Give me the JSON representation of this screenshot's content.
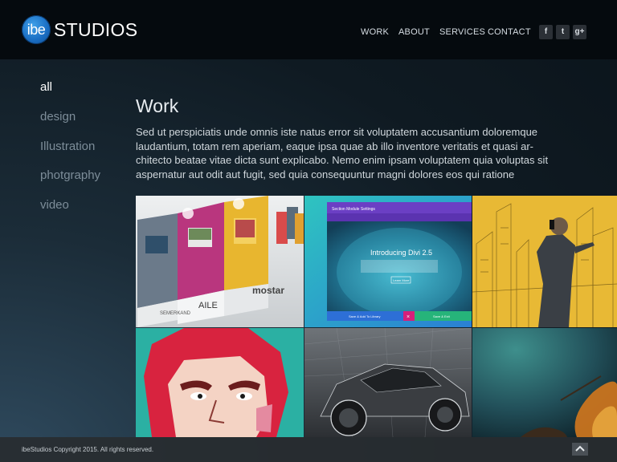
{
  "brand": {
    "logo_mark": "ibe",
    "logo_text": "STUDIOS"
  },
  "nav": {
    "items": [
      "WORK",
      "ABOUT",
      "SERVICES",
      "CONTACT"
    ]
  },
  "social": {
    "facebook": "f",
    "twitter": "t",
    "googleplus": "g+"
  },
  "sidebar": {
    "items": [
      "all",
      "design",
      "Illustration",
      "photgraphy",
      "video"
    ],
    "active": "all"
  },
  "main": {
    "title": "Work",
    "intro": "Sed ut perspiciatis unde omnis iste natus error sit voluptatem accusantium doloremque laudantium, totam rem aperiam, eaque ipsa quae ab illo inventore veritatis et quasi ar-chitecto beatae vitae dicta sunt explicabo. Nemo enim ipsam voluptatem quia voluptas sit aspernatur aut odit aut fugit, sed quia consequuntur magni dolores eos qui ratione"
  },
  "portfolio": {
    "brochure": {
      "label1": "SEMERKAND",
      "label2": "AILE",
      "label3": "mostar"
    },
    "divi": {
      "modal_title": "Section Module Settings",
      "headline": "Introducing Divi 2.5",
      "button": "Learn More",
      "save_library": "Save & Add To Library",
      "close": "×",
      "save_exit": "Save & Exit"
    }
  },
  "footer": {
    "copyright": "ibeStudios Copyright 2015. All rights reserved."
  },
  "colors": {
    "header": "#050a0e",
    "accent": "#1b6fc4",
    "active_text": "#ffffff",
    "muted_text": "#7d8d99"
  }
}
